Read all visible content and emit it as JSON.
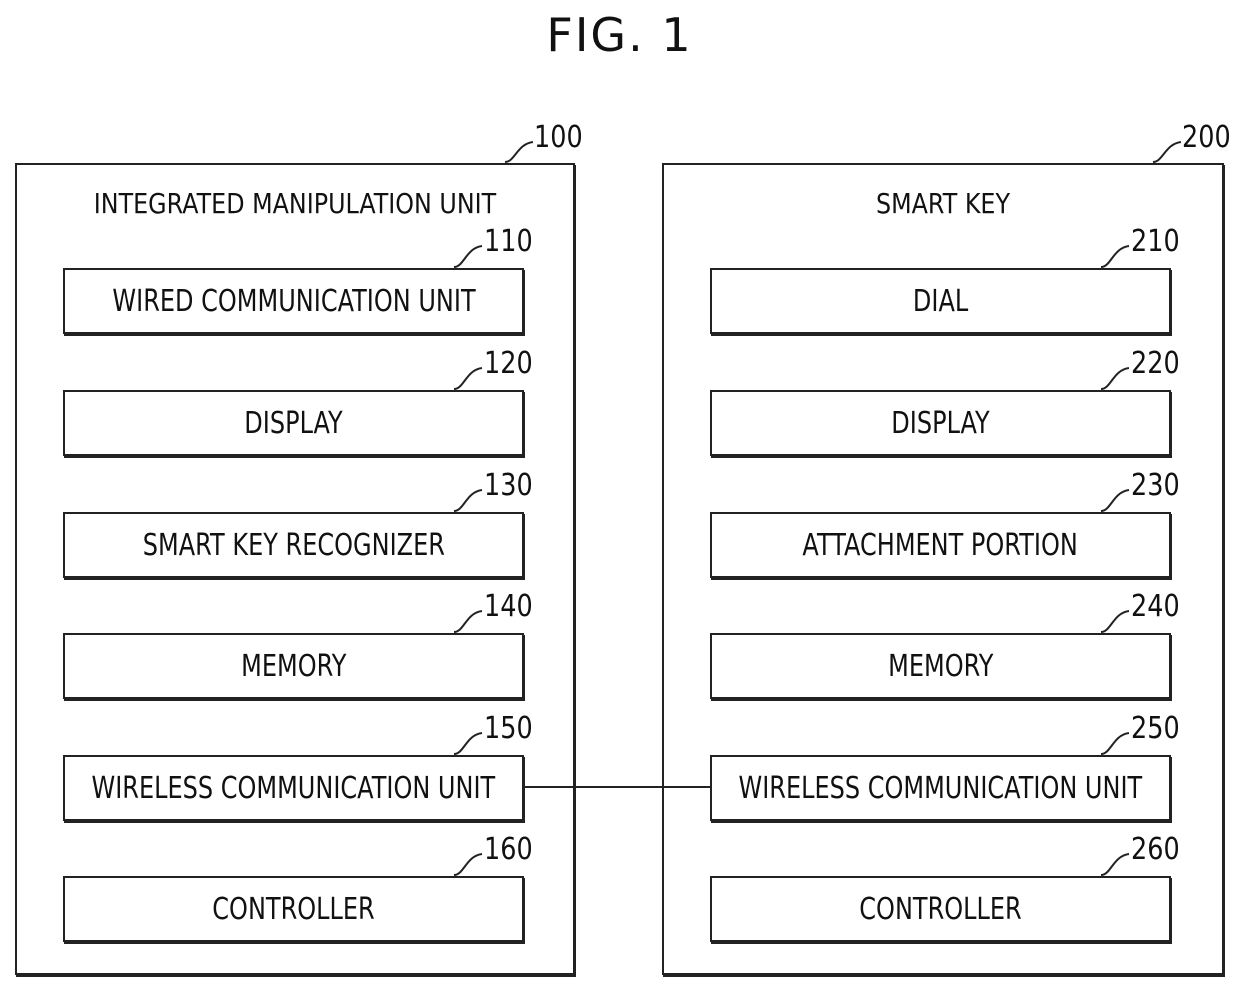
{
  "figure_title": "FIG. 1",
  "units": [
    {
      "ref": "100",
      "title": "INTEGRATED MANIPULATION UNIT",
      "blocks": [
        {
          "ref": "110",
          "label": "WIRED COMMUNICATION UNIT"
        },
        {
          "ref": "120",
          "label": "DISPLAY"
        },
        {
          "ref": "130",
          "label": "SMART KEY RECOGNIZER"
        },
        {
          "ref": "140",
          "label": "MEMORY"
        },
        {
          "ref": "150",
          "label": "WIRELESS COMMUNICATION UNIT"
        },
        {
          "ref": "160",
          "label": "CONTROLLER"
        }
      ]
    },
    {
      "ref": "200",
      "title": "SMART KEY",
      "blocks": [
        {
          "ref": "210",
          "label": "DIAL"
        },
        {
          "ref": "220",
          "label": "DISPLAY"
        },
        {
          "ref": "230",
          "label": "ATTACHMENT PORTION"
        },
        {
          "ref": "240",
          "label": "MEMORY"
        },
        {
          "ref": "250",
          "label": "WIRELESS COMMUNICATION UNIT"
        },
        {
          "ref": "260",
          "label": "CONTROLLER"
        }
      ]
    }
  ],
  "connections": [
    {
      "from": "150",
      "to": "250"
    }
  ]
}
